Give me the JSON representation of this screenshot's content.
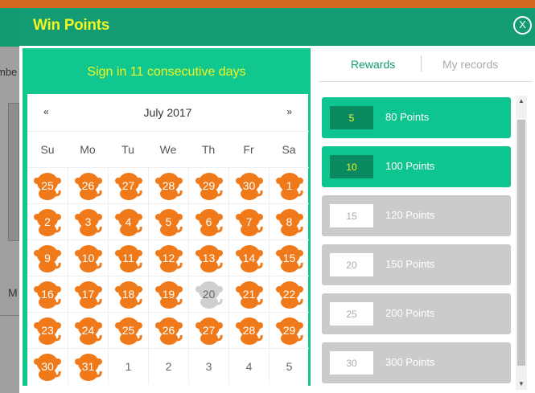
{
  "modal": {
    "title": "Win Points",
    "close_label": "X"
  },
  "background": {
    "fragment_text": "mbe",
    "fragment_m": "M"
  },
  "calendar": {
    "heading": "Sign in 11 consecutive days",
    "month_label": "July 2017",
    "prev_label": "«",
    "next_label": "»",
    "weekdays": [
      "Su",
      "Mo",
      "Tu",
      "We",
      "Th",
      "Fr",
      "Sa"
    ],
    "days": [
      {
        "n": "25",
        "s": "signed"
      },
      {
        "n": "26",
        "s": "signed"
      },
      {
        "n": "27",
        "s": "signed"
      },
      {
        "n": "28",
        "s": "signed"
      },
      {
        "n": "29",
        "s": "signed"
      },
      {
        "n": "30",
        "s": "signed"
      },
      {
        "n": "1",
        "s": "signed"
      },
      {
        "n": "2",
        "s": "signed"
      },
      {
        "n": "3",
        "s": "signed"
      },
      {
        "n": "4",
        "s": "signed"
      },
      {
        "n": "5",
        "s": "signed"
      },
      {
        "n": "6",
        "s": "signed"
      },
      {
        "n": "7",
        "s": "signed"
      },
      {
        "n": "8",
        "s": "signed"
      },
      {
        "n": "9",
        "s": "signed"
      },
      {
        "n": "10",
        "s": "signed"
      },
      {
        "n": "11",
        "s": "signed"
      },
      {
        "n": "12",
        "s": "signed"
      },
      {
        "n": "13",
        "s": "signed"
      },
      {
        "n": "14",
        "s": "signed"
      },
      {
        "n": "15",
        "s": "signed"
      },
      {
        "n": "16",
        "s": "signed"
      },
      {
        "n": "17",
        "s": "signed"
      },
      {
        "n": "18",
        "s": "signed"
      },
      {
        "n": "19",
        "s": "signed"
      },
      {
        "n": "20",
        "s": "missed"
      },
      {
        "n": "21",
        "s": "signed"
      },
      {
        "n": "22",
        "s": "signed"
      },
      {
        "n": "23",
        "s": "signed"
      },
      {
        "n": "24",
        "s": "signed"
      },
      {
        "n": "25",
        "s": "signed"
      },
      {
        "n": "26",
        "s": "signed"
      },
      {
        "n": "27",
        "s": "signed"
      },
      {
        "n": "28",
        "s": "signed"
      },
      {
        "n": "29",
        "s": "signed"
      },
      {
        "n": "30",
        "s": "signed"
      },
      {
        "n": "31",
        "s": "signed"
      },
      {
        "n": "1",
        "s": "none"
      },
      {
        "n": "2",
        "s": "none"
      },
      {
        "n": "3",
        "s": "none"
      },
      {
        "n": "4",
        "s": "none"
      },
      {
        "n": "5",
        "s": "none"
      }
    ],
    "colors": {
      "signed": "#f07a1a",
      "missed": "#cfcfcf"
    }
  },
  "tabs": {
    "rewards": "Rewards",
    "records": "My records"
  },
  "rewards": [
    {
      "days": "5",
      "label": "80 Points",
      "state": "active"
    },
    {
      "days": "10",
      "label": "100 Points",
      "state": "active"
    },
    {
      "days": "15",
      "label": "120 Points",
      "state": "inactive"
    },
    {
      "days": "20",
      "label": "150 Points",
      "state": "inactive"
    },
    {
      "days": "25",
      "label": "200 Points",
      "state": "inactive"
    },
    {
      "days": "30",
      "label": "300 Points",
      "state": "inactive"
    }
  ],
  "scrollbar": {
    "up_icon": "scroll-up-icon",
    "down_icon": "scroll-down-icon"
  }
}
